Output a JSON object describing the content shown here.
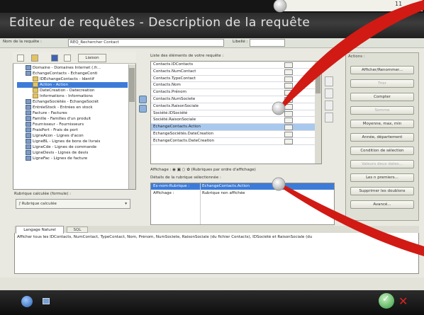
{
  "window": {
    "title": "Editeur de requêtes - Description de la requête",
    "top_right_text": "11"
  },
  "request": {
    "name_label": "Nom de la requête :",
    "name_value": "REQ_Rechercher Contact",
    "language_label": "Libellé :"
  },
  "tree": {
    "level_button": "Liaison",
    "items": [
      {
        "label": "Domaine - Domaines Internet (.fr...",
        "type": "table",
        "selected": false
      },
      {
        "label": "EchangeContacts - EchangeConti",
        "type": "table",
        "selected": false
      },
      {
        "label": "IDEchangeContacts - Identif",
        "type": "key",
        "selected": false
      },
      {
        "label": "Action - Action",
        "type": "field",
        "selected": true
      },
      {
        "label": "DateCreation - Datecreation",
        "type": "field",
        "selected": false
      },
      {
        "label": "Informations - Informations",
        "type": "field",
        "selected": false
      },
      {
        "label": "EchangeSociétés - EchangeSociét",
        "type": "table",
        "selected": false
      },
      {
        "label": "EntréeStock - Entrées en stock",
        "type": "table",
        "selected": false
      },
      {
        "label": "Facture - Factures",
        "type": "table",
        "selected": false
      },
      {
        "label": "Famille - Familles d'un produit",
        "type": "table",
        "selected": false
      },
      {
        "label": "Fournisseur - Fournisseurs",
        "type": "table",
        "selected": false
      },
      {
        "label": "FraisPort - Frais de port",
        "type": "table",
        "selected": false
      },
      {
        "label": "LigneAcon - Lignes d'acon",
        "type": "table",
        "selected": false
      },
      {
        "label": "LigneBL - Lignes de bons de livrais",
        "type": "table",
        "selected": false
      },
      {
        "label": "LigneCde - Lignes de commande",
        "type": "table",
        "selected": false
      },
      {
        "label": "LigneDevis - Lignes de devis",
        "type": "table",
        "selected": false
      },
      {
        "label": "LigneFac - Lignes de facture",
        "type": "table",
        "selected": false
      }
    ]
  },
  "computed": {
    "label": "Rubrique calculée (formule) :",
    "combo_value": "Rubrique calculée"
  },
  "center": {
    "heading": "Liste des éléments de votre requête :",
    "rows": [
      {
        "label": "Contacts.IDContacts",
        "selected": false
      },
      {
        "label": "Contacts.NumContact",
        "selected": false
      },
      {
        "label": "Contacts.TypeContact",
        "selected": false
      },
      {
        "label": "Contacts.Nom",
        "selected": false
      },
      {
        "label": "Contacts.Prénom",
        "selected": false
      },
      {
        "label": "Contacts.NumSociete",
        "selected": false
      },
      {
        "label": "Contacts.RaisonSociale",
        "selected": false
      },
      {
        "label": "Société.IDSociété",
        "selected": false
      },
      {
        "label": "Société.RaisonSociale",
        "selected": false
      },
      {
        "label": "EchangeContacts.Action",
        "selected": true
      },
      {
        "label": "EchangeSociétés.DateCreation",
        "selected": false
      },
      {
        "label": "EchangeContacts.DateCreation",
        "selected": false
      }
    ],
    "display_row": "Affichage :  ◉  ▣   ○  ✿   (Rubriques par ordre d'affichage)",
    "detail_heading": "Détails de la rubrique sélectionnée :"
  },
  "detail": {
    "row1_key": "Ex-nom-Rubrique :",
    "row1_value": "EchangeContacts.Action",
    "row2_key": "Affichage :",
    "row2_value": "Rubrique non affichée"
  },
  "actions": {
    "title": "Actions :",
    "buttons": [
      {
        "label": "Afficher/Renommer...",
        "disabled": false
      },
      {
        "label": "Trier",
        "disabled": true
      },
      {
        "label": "Compter",
        "disabled": false
      },
      {
        "label": "Somme",
        "disabled": true
      },
      {
        "label": "Moyenne, max, min",
        "disabled": false
      },
      {
        "label": "Année, département",
        "disabled": false
      },
      {
        "label": "Condition de sélection",
        "disabled": false
      },
      {
        "label": "Valeurs deux dates...",
        "disabled": true
      },
      {
        "label": "Les n premiers...",
        "disabled": false
      },
      {
        "label": "Supprimer les doublons",
        "disabled": false
      },
      {
        "label": "Avancé...",
        "disabled": false
      }
    ]
  },
  "tabs": {
    "natural": "Langage Naturel",
    "sql": "SQL",
    "natural_text": "Afficher tous les IDContacts, NumContact, TypeContact, Nom, Prénom, NumSociete, RaisonSociale (du fichier Contacts), IDSociété et RaisonSociale (du"
  },
  "bottom": {
    "ok_glyph": "✓",
    "cancel_glyph": "✕"
  },
  "colors": {
    "title_bg": "#2b2b2b",
    "selection": "#3d7bd8",
    "pointer_red": "#d11a14"
  }
}
